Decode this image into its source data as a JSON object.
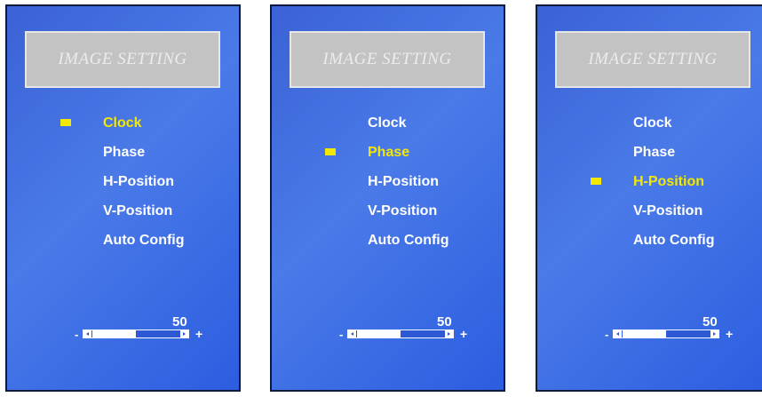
{
  "colors": {
    "panel_background": "#3f6be0",
    "title_box": "#c3c3c3",
    "selected_text": "#f5e800",
    "menu_text": "#ffffff"
  },
  "panels": [
    {
      "title": "IMAGE SETTING",
      "items": [
        "Clock",
        "Phase",
        "H-Position",
        "V-Position",
        "Auto Config"
      ],
      "selected_index": 0,
      "slider": {
        "value": "50",
        "minus": "-",
        "plus": "+",
        "level": 0.5
      }
    },
    {
      "title": "IMAGE SETTING",
      "items": [
        "Clock",
        "Phase",
        "H-Position",
        "V-Position",
        "Auto Config"
      ],
      "selected_index": 1,
      "slider": {
        "value": "50",
        "minus": "-",
        "plus": "+",
        "level": 0.5
      }
    },
    {
      "title": "IMAGE SETTING",
      "items": [
        "Clock",
        "Phase",
        "H-Position",
        "V-Position",
        "Auto Config"
      ],
      "selected_index": 2,
      "slider": {
        "value": "50",
        "minus": "-",
        "plus": "+",
        "level": 0.5
      }
    }
  ]
}
